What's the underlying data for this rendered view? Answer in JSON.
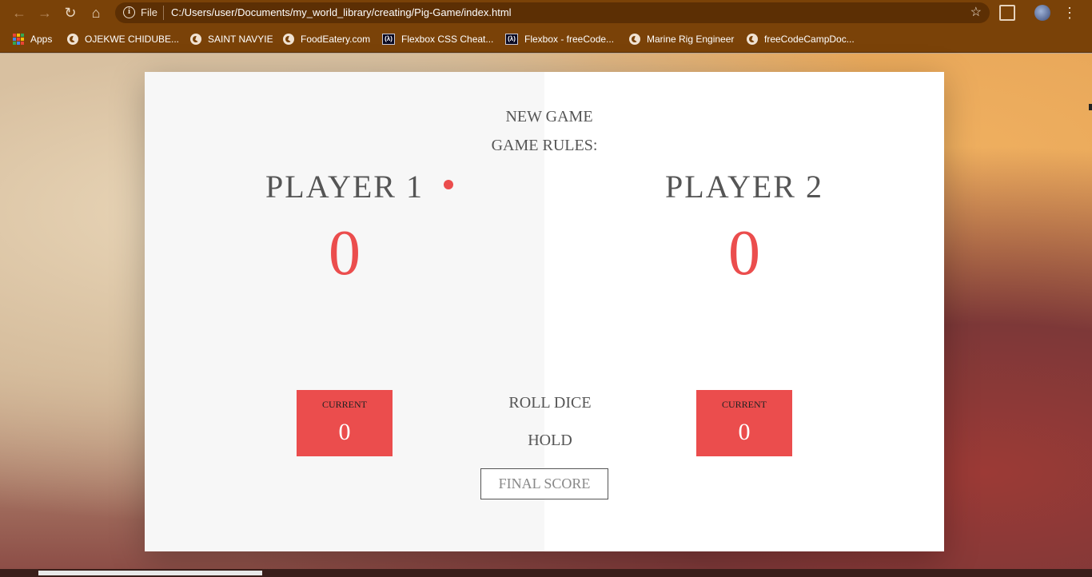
{
  "browser": {
    "scheme": "File",
    "url": "C:/Users/user/Documents/my_world_library/creating/Pig-Game/index.html",
    "bookmarks": [
      {
        "label": "Apps",
        "icon": "apps-grid-icon"
      },
      {
        "label": "OJEKWE CHIDUBE...",
        "icon": "globe-icon"
      },
      {
        "label": "SAINT NAVYIE",
        "icon": "globe-icon"
      },
      {
        "label": "FoodEatery.com",
        "icon": "globe-icon"
      },
      {
        "label": "Flexbox  CSS Cheat...",
        "icon": "freecodecamp-icon"
      },
      {
        "label": "Flexbox - freeCode...",
        "icon": "freecodecamp-icon"
      },
      {
        "label": "Marine Rig Engineer",
        "icon": "globe-icon"
      },
      {
        "label": "freeCodeCampDoc...",
        "icon": "globe-icon"
      }
    ]
  },
  "game": {
    "new_game": "NEW GAME",
    "game_rules": "GAME RULES:",
    "roll_dice": "ROLL DICE",
    "hold": "HOLD",
    "final_score_placeholder": "FINAL SCORE",
    "players": [
      {
        "name": "PLAYER 1",
        "score": "0",
        "current_label": "CURRENT",
        "current_score": "0",
        "active": true
      },
      {
        "name": "PLAYER 2",
        "score": "0",
        "current_label": "CURRENT",
        "current_score": "0",
        "active": false
      }
    ],
    "accent_color": "#eb4d4d"
  }
}
